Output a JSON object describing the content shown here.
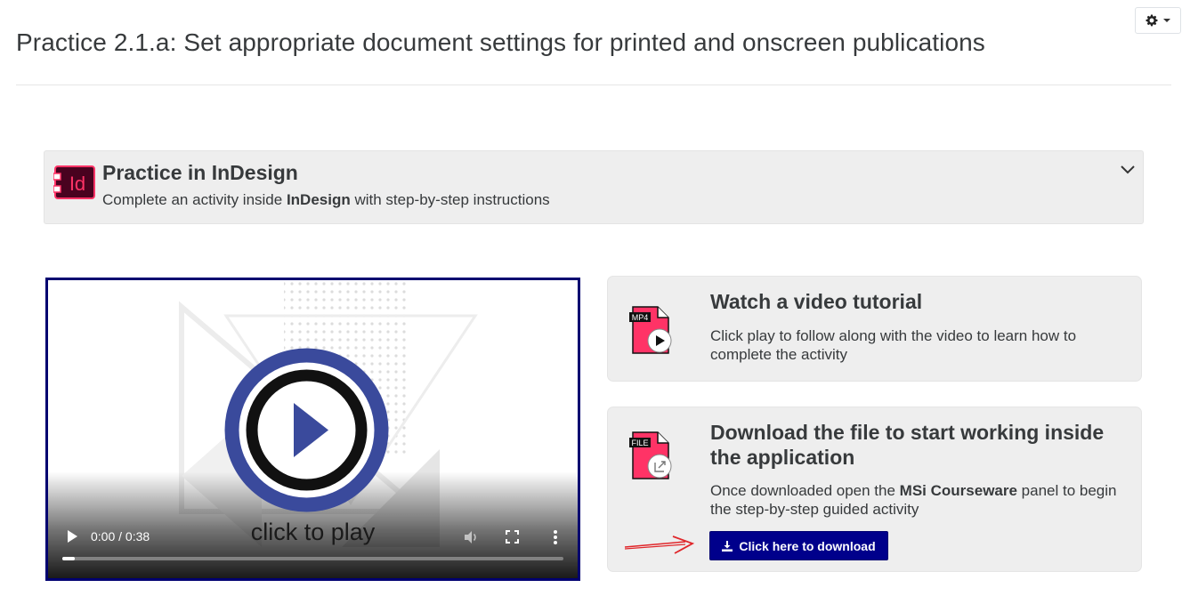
{
  "page": {
    "title": "Practice 2.1.a: Set appropriate document settings for printed and onscreen publications"
  },
  "practice_panel": {
    "logo_text": "Id",
    "title": "Practice in InDesign",
    "subtitle_before": "Complete an activity inside ",
    "subtitle_bold": "InDesign",
    "subtitle_after": " with step-by-step instructions"
  },
  "video": {
    "overlay_text": "click to play",
    "time": "0:00 / 0:38",
    "progress_fraction": 0.025
  },
  "video_card": {
    "icon_label": "MP4",
    "title": "Watch a video tutorial",
    "text": "Click play to follow along with the video to learn how to complete the activity"
  },
  "download_card": {
    "icon_label": "FILE",
    "title": "Download the file to start working inside the application",
    "text_before": "Once downloaded open the ",
    "text_bold": "MSi Courseware",
    "text_after": " panel to begin the step-by-step guided activity",
    "button_label": "Click here to download"
  },
  "colors": {
    "accent": "#00008b",
    "video_border": "#000070",
    "indesign_pink": "#ff3366",
    "indesign_dark": "#49021f",
    "play_ring": "#3a4a9c",
    "arrow_red": "#e0262a",
    "panel_bg": "#eeeeee"
  },
  "icons": {
    "settings": "gear-icon",
    "expand": "chevron-down-icon",
    "download": "download-icon"
  }
}
